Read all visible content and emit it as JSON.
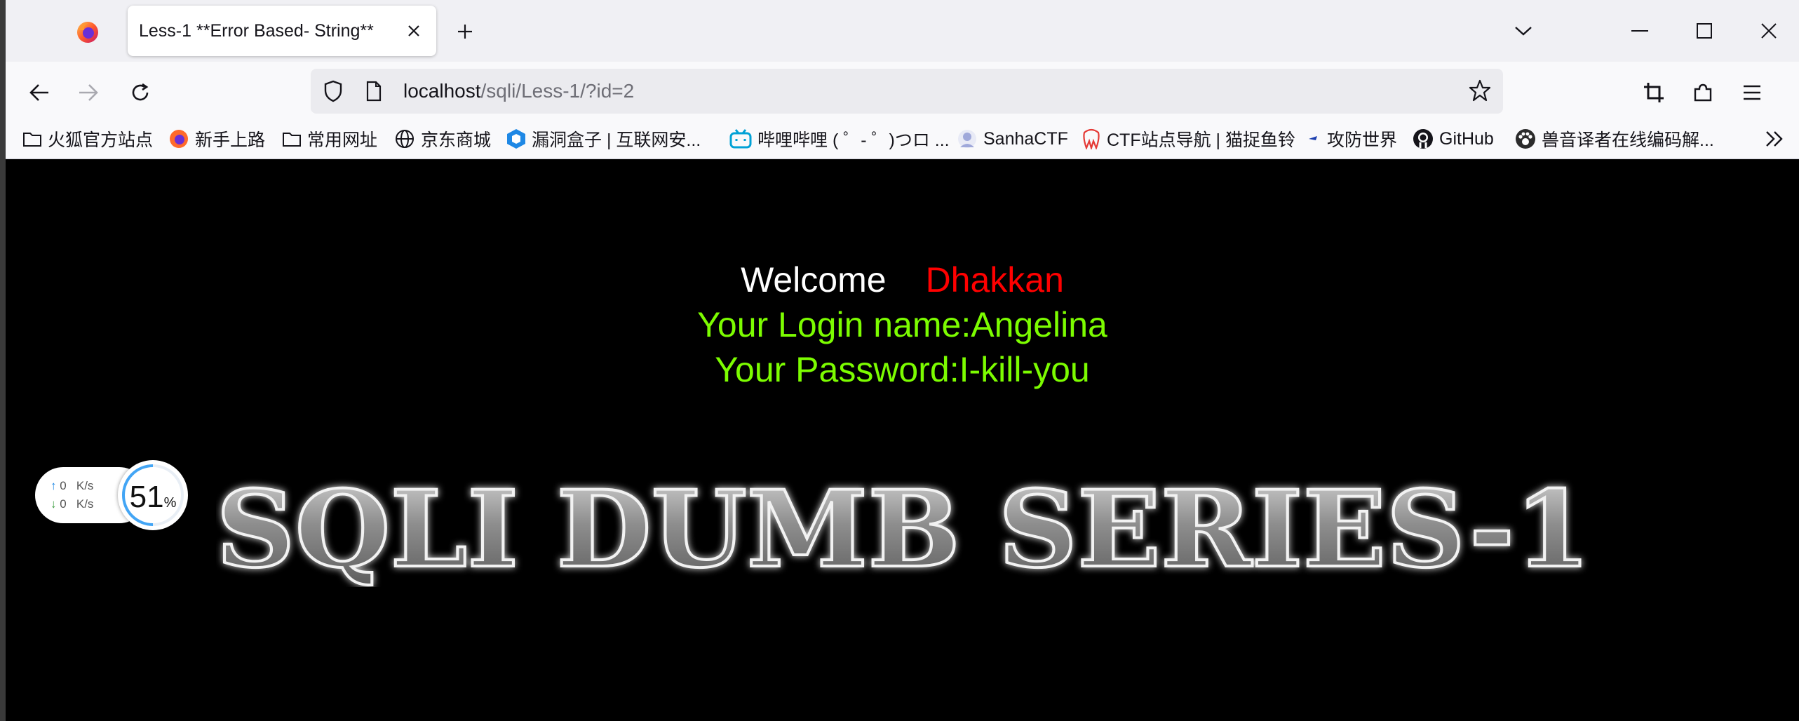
{
  "browser": {
    "tab_title": "Less-1 **Error Based- String**",
    "url_host": "localhost",
    "url_path": "/sqli/Less-1/?id=2"
  },
  "bookmarks": [
    {
      "label": "火狐官方站点",
      "icon": "folder-icon"
    },
    {
      "label": "新手上路",
      "icon": "firefox-icon"
    },
    {
      "label": "常用网址",
      "icon": "folder-icon"
    },
    {
      "label": "京东商城",
      "icon": "globe-icon"
    },
    {
      "label": "漏洞盒子 | 互联网安...",
      "icon": "hexagon-icon"
    },
    {
      "label": "哔哩哔哩 ( ゜- ゜)つロ ...",
      "icon": "bilibili-icon"
    },
    {
      "label": "SanhaCTF",
      "icon": "avatar-icon"
    },
    {
      "label": "CTF站点导航 | 猫捉鱼铃",
      "icon": "tooth-icon"
    },
    {
      "label": "攻防世界",
      "icon": "flag-icon"
    },
    {
      "label": "GitHub",
      "icon": "github-icon"
    },
    {
      "label": "兽音译者在线编码解...",
      "icon": "paw-icon"
    }
  ],
  "page": {
    "welcome": "Welcome",
    "name": "Dhakkan",
    "login_line": "Your Login name:Angelina",
    "password_line": "Your Password:I-kill-you",
    "banner_text": "SQLI DUMB SERIES-1"
  },
  "net_widget": {
    "up_rate": "0",
    "down_rate": "0",
    "unit": "K/s",
    "percent": "51",
    "percent_sign": "%"
  },
  "colors": {
    "welcome": "#ffffff",
    "name": "#ff0000",
    "credentials": "#7cfc00",
    "background": "#000000"
  }
}
